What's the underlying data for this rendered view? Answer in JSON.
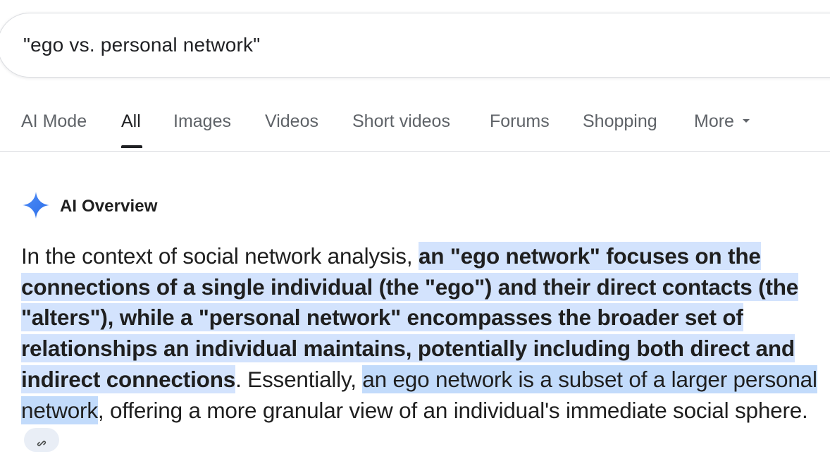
{
  "search": {
    "query": "\"ego vs. personal network\""
  },
  "tabs": [
    {
      "label": "AI Mode"
    },
    {
      "label": "All"
    },
    {
      "label": "Images"
    },
    {
      "label": "Videos"
    },
    {
      "label": "Short videos"
    },
    {
      "label": "Forums"
    },
    {
      "label": "Shopping"
    },
    {
      "label": "More"
    }
  ],
  "active_tab": "All",
  "ai_overview": {
    "title": "AI Overview",
    "icon": "sparkle-icon",
    "icon_color": "#4285f4",
    "segments": {
      "intro": "In the context of social network analysis, ",
      "highlight_bold": "an \"ego network\" focuses on the connections of a single individual (the \"ego\") and their direct contacts (the \"alters\"), while a \"personal network\" encompasses the broader set of relationships an individual maintains, potentially including both direct and indirect connections",
      "middle": ". Essentially, ",
      "highlight": "an ego network is a subset of a larger personal network",
      "ending": ", offering a more granular view of an individual's immediate social sphere. "
    },
    "link_icon": "link-icon"
  },
  "colors": {
    "highlight_bold_bg": "#d3e3fd",
    "highlight_bg": "#c2dbfb",
    "text": "#1f1f1f",
    "tab_inactive": "#5f6368"
  }
}
